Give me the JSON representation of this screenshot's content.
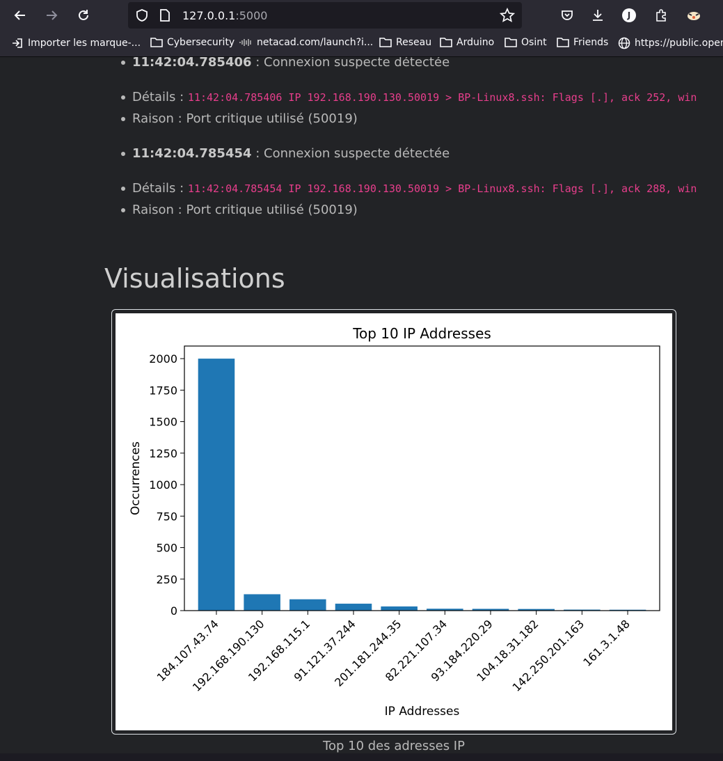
{
  "browser": {
    "url_host": "127.0.0.1",
    "url_port": ":5000",
    "profile_initial": "J",
    "bookmarks": [
      {
        "label": "Importer les marque-...",
        "icon": "import-icon"
      },
      {
        "label": "Cybersecurity",
        "icon": "folder-icon"
      },
      {
        "label": "netacad.com/launch?i...",
        "icon": "cisco-icon"
      },
      {
        "label": "Reseau",
        "icon": "folder-icon"
      },
      {
        "label": "Arduino",
        "icon": "folder-icon"
      },
      {
        "label": "Osint",
        "icon": "folder-icon"
      },
      {
        "label": "Friends",
        "icon": "folder-icon"
      },
      {
        "label": "https://public.opendatasoft.com",
        "icon": "globe-icon"
      }
    ]
  },
  "alerts": [
    {
      "time": "11:42:04.785406",
      "message": " : Connexion suspecte détectée",
      "details_label": "Détails : ",
      "details": "11:42:04.785406 IP 192.168.190.130.50019 > BP-Linux8.ssh: Flags [.], ack 252, win",
      "reason": "Raison : Port critique utilisé (50019)"
    },
    {
      "time": "11:42:04.785454",
      "message": " : Connexion suspecte détectée",
      "details_label": "Détails : ",
      "details": "11:42:04.785454 IP 192.168.190.130.50019 > BP-Linux8.ssh: Flags [.], ack 288, win",
      "reason": "Raison : Port critique utilisé (50019)"
    }
  ],
  "section_title": "Visualisations",
  "caption": "Top 10 des adresses IP",
  "colors": {
    "bar": "#1f77b4",
    "code": "#e83e8c"
  },
  "chart_data": {
    "type": "bar",
    "title": "Top 10 IP Addresses",
    "xlabel": "IP Addresses",
    "ylabel": "Occurrences",
    "categories": [
      "184.107.43.74",
      "192.168.190.130",
      "192.168.115.1",
      "91.121.37.244",
      "201.181.244.35",
      "82.221.107.34",
      "93.184.220.29",
      "104.18.31.182",
      "142.250.201.163",
      "161.3.1.48"
    ],
    "values": [
      2000,
      130,
      90,
      55,
      33,
      15,
      14,
      13,
      8,
      7
    ],
    "ylim": [
      0,
      2100
    ],
    "yticks": [
      0,
      250,
      500,
      750,
      1000,
      1250,
      1500,
      1750,
      2000
    ],
    "grid": false
  }
}
